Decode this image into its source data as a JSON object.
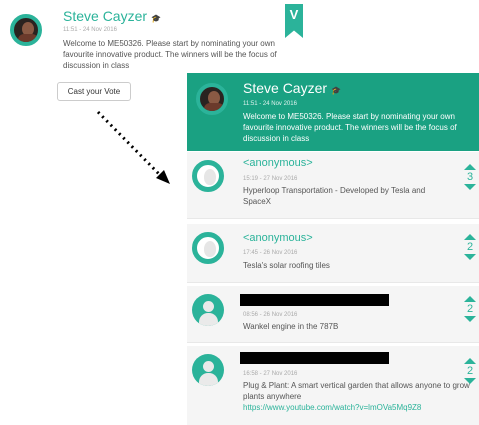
{
  "post": {
    "author": "Steve Cayzer",
    "time": "11:51 - 24 Nov 2016",
    "message": "Welcome to ME50326. Please start by nominating your own favourite innovative product. The winners will be the focus of discussion in class",
    "cast_vote_label": "Cast your Vote",
    "grad_cap": "🎓"
  },
  "bookmark_letter": "V",
  "panel": {
    "author": "Steve Cayzer",
    "time": "11:51 - 24 Nov 2016",
    "message": "Welcome to ME50326. Please start by nominating your own favourite innovative product. The winners will be the focus of discussion in class"
  },
  "entries": [
    {
      "author": "<anonymous>",
      "time": "15:19 - 27 Nov 2016",
      "text": "Hyperloop Transportation - Developed by Tesla and SpaceX",
      "votes": "3"
    },
    {
      "author": "<anonymous>",
      "time": "17:45 - 26 Nov 2016",
      "text": "Tesla's solar roofing tiles",
      "votes": "2"
    },
    {
      "author": "",
      "time": "08:56 - 26 Nov 2016",
      "text": "Wankel engine in the 787B",
      "votes": "2"
    },
    {
      "author": "",
      "time": "16:58 - 27 Nov 2016",
      "text": "Plug & Plant: A smart vertical garden that allows anyone to grow plants anywhere",
      "link": "https://www.youtube.com/watch?v=lmOVa5Mq9Z8",
      "votes": "2"
    }
  ],
  "colors": {
    "accent": "#2bb39a",
    "panel": "#1aa182"
  }
}
